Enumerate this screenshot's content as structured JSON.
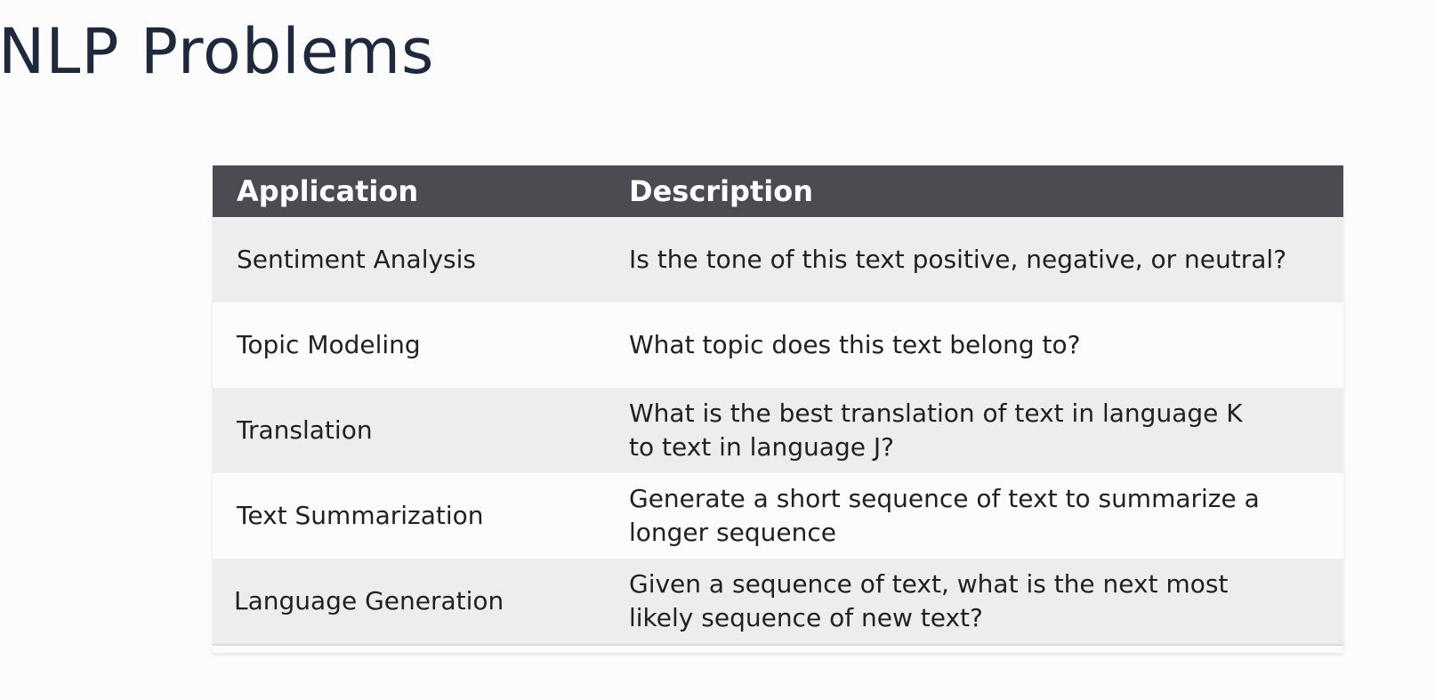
{
  "slide": {
    "title": "NLP Problems"
  },
  "table": {
    "headers": {
      "application": "Application",
      "description": "Description"
    },
    "rows": [
      {
        "application": "Sentiment Analysis",
        "description": "Is the tone of this text positive, negative, or neutral?"
      },
      {
        "application": "Topic Modeling",
        "description": "What topic does this text belong to?"
      },
      {
        "application": "Translation",
        "description": "What is the best translation of text in language K to text in language J?"
      },
      {
        "application": "Text Summarization",
        "description": "Generate a short sequence of text to summarize a longer sequence"
      },
      {
        "application": "Language Generation",
        "description": "Given a sequence of text, what is the next most likely sequence of new text?"
      }
    ]
  },
  "colors": {
    "title": "#1e2a3c",
    "header_bg": "#4b4c52",
    "header_text": "#ffffff",
    "row_shaded": "#ededee",
    "row_plain": "#fbfbfb",
    "body_text": "#202124"
  }
}
